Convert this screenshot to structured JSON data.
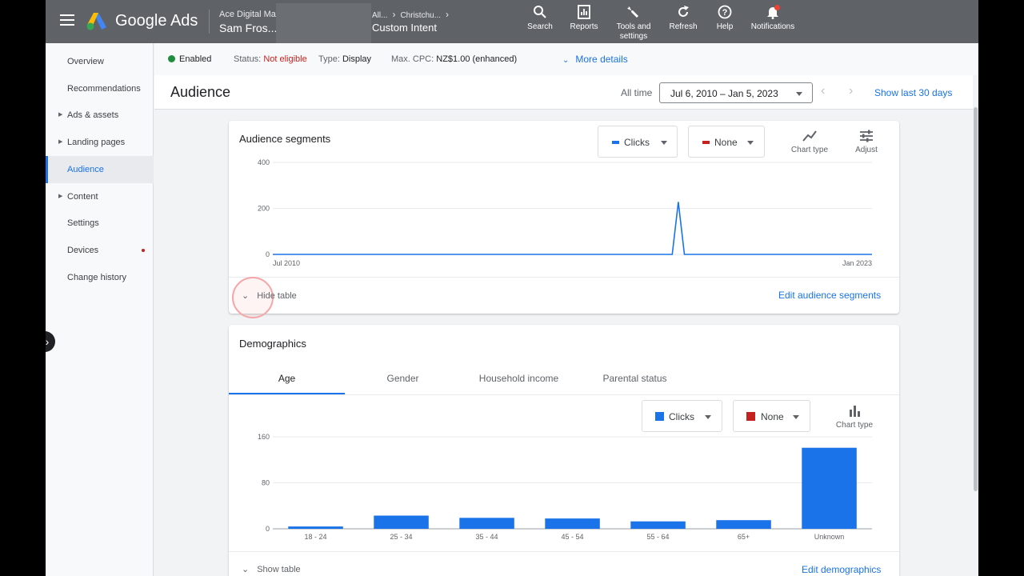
{
  "topbar": {
    "brand": "Google Ads",
    "account_name": "Ace Digital Mar",
    "account_user": "Sam Fros...",
    "breadcrumb": [
      "All...",
      "Christchu..."
    ],
    "breadcrumb_title": "Custom Intent",
    "tools": [
      {
        "label": "Search",
        "icon": "search-icon"
      },
      {
        "label": "Reports",
        "icon": "reports-icon"
      },
      {
        "label": "Tools and settings",
        "icon": "wrench-icon"
      },
      {
        "label": "Refresh",
        "icon": "refresh-icon"
      },
      {
        "label": "Help",
        "icon": "help-icon"
      },
      {
        "label": "Notifications",
        "icon": "bell-icon"
      }
    ]
  },
  "sidebar": {
    "items": [
      {
        "label": "Overview",
        "expandable": false,
        "active": false
      },
      {
        "label": "Recommendations",
        "expandable": false,
        "active": false
      },
      {
        "label": "Ads & assets",
        "expandable": true,
        "active": false
      },
      {
        "label": "Landing pages",
        "expandable": true,
        "active": false
      },
      {
        "label": "Audience",
        "expandable": false,
        "active": true
      },
      {
        "label": "Content",
        "expandable": true,
        "active": false
      },
      {
        "label": "Settings",
        "expandable": false,
        "active": false
      },
      {
        "label": "Devices",
        "expandable": false,
        "active": false,
        "alert": true
      },
      {
        "label": "Change history",
        "expandable": false,
        "active": false
      }
    ]
  },
  "status": {
    "enabled": "Enabled",
    "status_label": "Status:",
    "status_value": "Not eligible",
    "type_label": "Type:",
    "type_value": "Display",
    "cpc_label": "Max. CPC:",
    "cpc_value": "NZ$1.00 (enhanced)",
    "more_details": "More details"
  },
  "header": {
    "title": "Audience",
    "all_time": "All time",
    "date_range": "Jul 6, 2010 – Jan 5, 2023",
    "show_last": "Show last 30 days"
  },
  "segments": {
    "title": "Audience segments",
    "metric1": "Clicks",
    "metric2": "None",
    "chart_type": "Chart type",
    "adjust": "Adjust",
    "hide_table": "Hide table",
    "edit_link": "Edit audience segments"
  },
  "demographics": {
    "title": "Demographics",
    "tabs": [
      "Age",
      "Gender",
      "Household income",
      "Parental status"
    ],
    "metric1": "Clicks",
    "metric2": "None",
    "chart_type": "Chart type",
    "show_table": "Show table",
    "edit_link": "Edit demographics"
  },
  "colors": {
    "series1": "#1a73e8",
    "series2": "#c5221f"
  },
  "chart_data": [
    {
      "type": "line",
      "title": "Audience segments",
      "x": [
        "Jul 2010",
        "Jan 2023"
      ],
      "series": [
        {
          "name": "Clicks",
          "values": [
            0,
            0,
            0,
            0,
            0,
            0,
            0,
            0,
            0,
            0,
            0,
            0,
            0,
            0,
            0,
            0,
            0,
            0,
            0,
            0,
            0,
            0,
            0,
            0,
            0,
            0,
            0,
            0,
            0,
            0,
            0,
            0,
            0,
            0,
            0,
            0,
            0,
            0,
            0,
            0,
            0,
            0,
            0,
            0,
            0,
            0,
            0,
            0,
            0,
            0,
            0,
            0,
            0,
            0,
            0,
            0,
            0,
            0,
            0,
            0,
            0,
            0,
            0,
            0,
            0,
            0,
            0,
            228,
            0,
            0,
            0,
            0,
            0,
            0,
            0,
            0,
            0,
            0,
            0,
            0,
            0,
            0,
            0,
            0,
            0,
            0,
            0,
            0,
            0,
            0,
            0,
            0,
            0,
            0,
            0,
            0,
            0,
            0,
            0,
            0
          ]
        }
      ],
      "yticks": [
        0,
        200,
        400
      ],
      "ylim": [
        0,
        400
      ],
      "grid": true
    },
    {
      "type": "bar",
      "title": "Demographics - Age",
      "categories": [
        "18 - 24",
        "25 - 34",
        "35 - 44",
        "45 - 54",
        "55 - 64",
        "65+",
        "Unknown"
      ],
      "series": [
        {
          "name": "Clicks",
          "values": [
            4,
            23,
            19,
            18,
            13,
            15,
            141
          ]
        }
      ],
      "yticks": [
        0,
        80,
        160
      ],
      "ylim": [
        0,
        160
      ],
      "grid": true
    }
  ]
}
